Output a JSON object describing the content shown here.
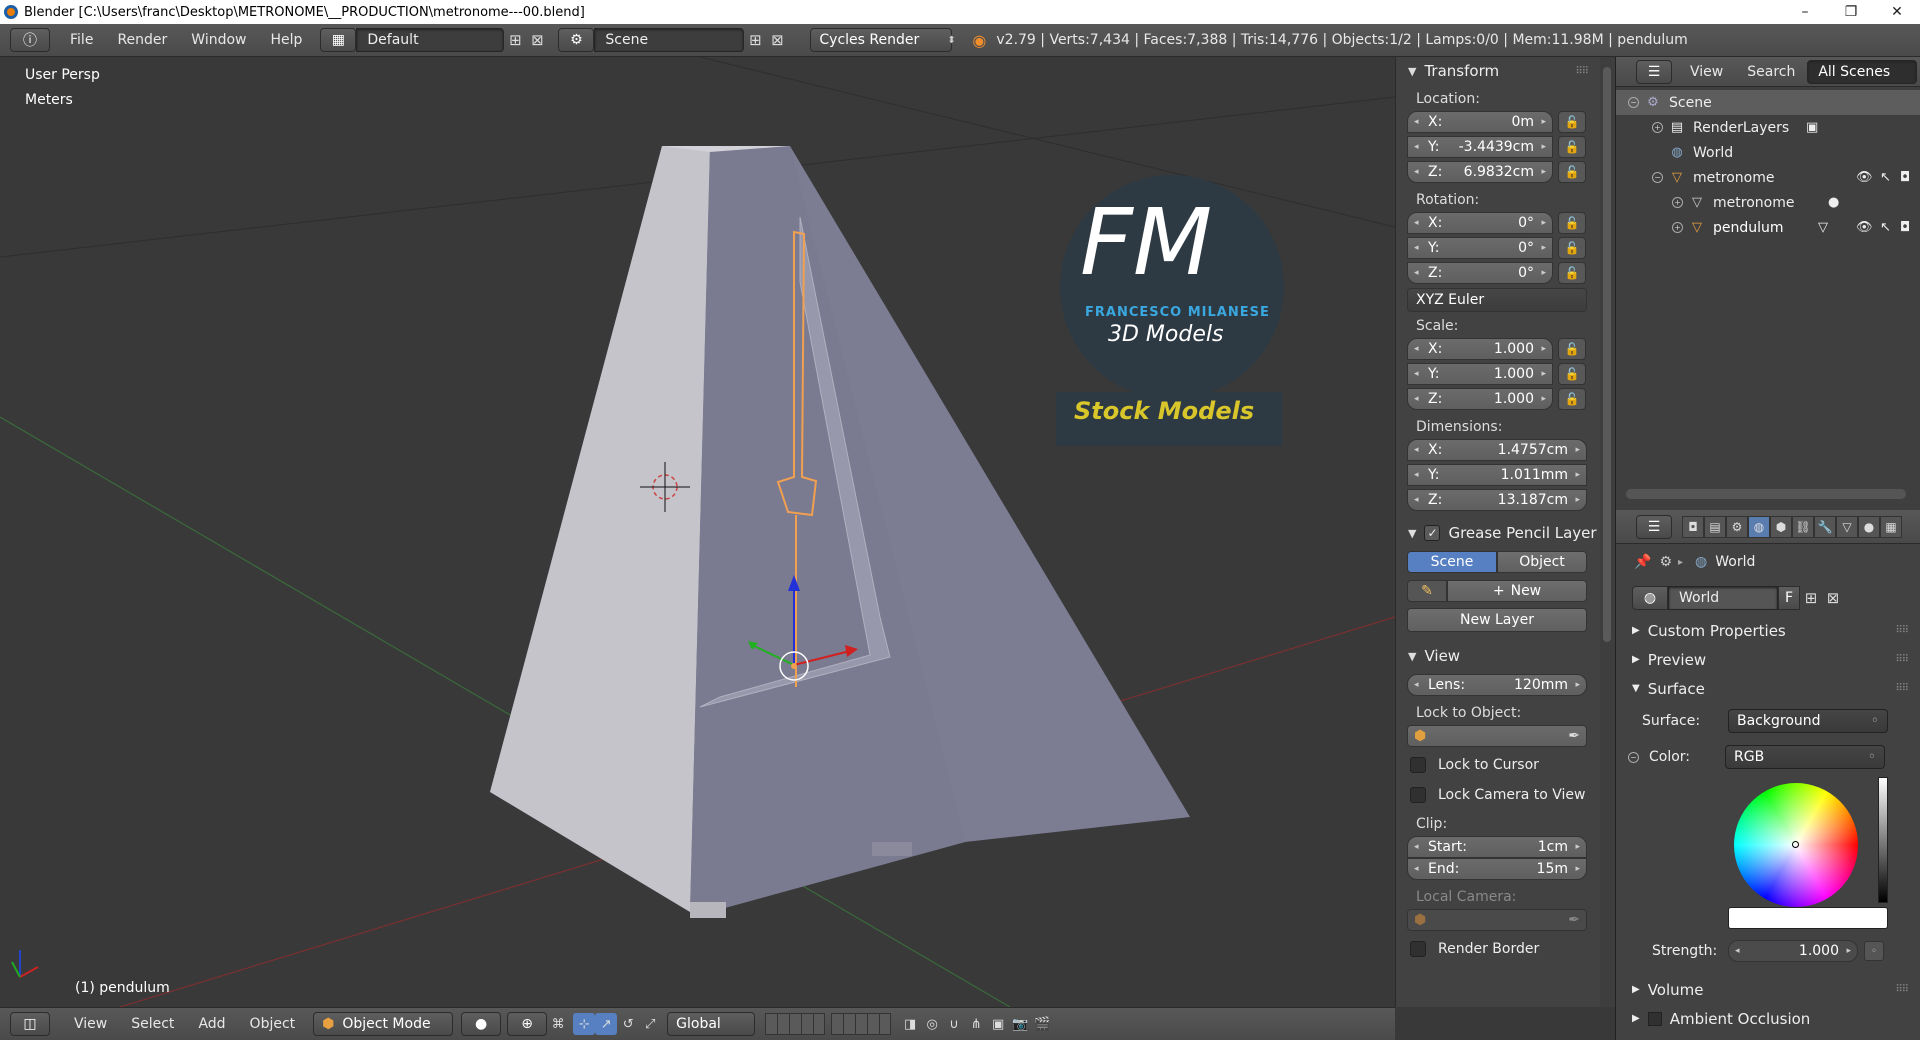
{
  "titlebar": {
    "title": "Blender [C:\\Users\\franc\\Desktop\\METRONOME\\__PRODUCTION\\metronome---00.blend]",
    "minimize": "–",
    "maximize": "❐",
    "close": "✕"
  },
  "infobar": {
    "menus": [
      "File",
      "Render",
      "Window",
      "Help"
    ],
    "screen_layout": "Default",
    "scene": "Scene",
    "render_engine": "Cycles Render",
    "stats": "v2.79 | Verts:7,434 | Faces:7,388 | Tris:14,776 | Objects:1/2 | Lamps:0/0 | Mem:11.98M | pendulum"
  },
  "viewport": {
    "view_name": "User Persp",
    "units": "Meters",
    "active_object": "(1) pendulum",
    "logo": {
      "initials": "FM",
      "name": "FRANCESCO MILANESE",
      "subtitle": "3D Models",
      "banner": "Stock Models"
    }
  },
  "transform": {
    "title": "Transform",
    "location_label": "Location:",
    "location": [
      {
        "k": "X:",
        "v": "0m"
      },
      {
        "k": "Y:",
        "v": "-3.4439cm"
      },
      {
        "k": "Z:",
        "v": "6.9832cm"
      }
    ],
    "rotation_label": "Rotation:",
    "rotation": [
      {
        "k": "X:",
        "v": "0°"
      },
      {
        "k": "Y:",
        "v": "0°"
      },
      {
        "k": "Z:",
        "v": "0°"
      }
    ],
    "rotation_mode": "XYZ Euler",
    "scale_label": "Scale:",
    "scale": [
      {
        "k": "X:",
        "v": "1.000"
      },
      {
        "k": "Y:",
        "v": "1.000"
      },
      {
        "k": "Z:",
        "v": "1.000"
      }
    ],
    "dimensions_label": "Dimensions:",
    "dimensions": [
      {
        "k": "X:",
        "v": "1.4757cm"
      },
      {
        "k": "Y:",
        "v": "1.011mm"
      },
      {
        "k": "Z:",
        "v": "13.187cm"
      }
    ]
  },
  "grease_pencil": {
    "title": "Grease Pencil Layer",
    "scene_tab": "Scene",
    "object_tab": "Object",
    "new_label": "New",
    "new_layer_label": "New Layer"
  },
  "view_panel": {
    "title": "View",
    "lens_key": "Lens:",
    "lens_value": "120mm",
    "lock_to_object": "Lock to Object:",
    "lock_to_cursor": "Lock to Cursor",
    "lock_camera": "Lock Camera to View",
    "clip_label": "Clip:",
    "clip_start_key": "Start:",
    "clip_start": "1cm",
    "clip_end_key": "End:",
    "clip_end": "15m",
    "local_camera": "Local Camera:",
    "render_border": "Render Border"
  },
  "outliner": {
    "menus": [
      "View",
      "Search"
    ],
    "filter": "All Scenes",
    "items": [
      "Scene",
      "RenderLayers",
      "World",
      "metronome",
      "metronome",
      "pendulum"
    ]
  },
  "properties": {
    "context_world": "World",
    "world_field": "World",
    "fake_user": "F",
    "sections": {
      "custom_properties": "Custom Properties",
      "preview": "Preview",
      "surface": "Surface",
      "volume": "Volume",
      "ambient_occlusion": "Ambient Occlusion"
    },
    "surface_label": "Surface:",
    "surface_value": "Background",
    "color_label": "Color:",
    "color_value": "RGB",
    "strength_label": "Strength:",
    "strength_value": "1.000"
  },
  "bottombar": {
    "menus": [
      "View",
      "Select",
      "Add",
      "Object"
    ],
    "mode": "Object Mode",
    "orientation": "Global"
  },
  "colors": {
    "accent_blue": "#5680c2",
    "selection_orange": "#f0a050",
    "header_gray": "#4f4f4f",
    "viewport_bg": "#393939"
  }
}
